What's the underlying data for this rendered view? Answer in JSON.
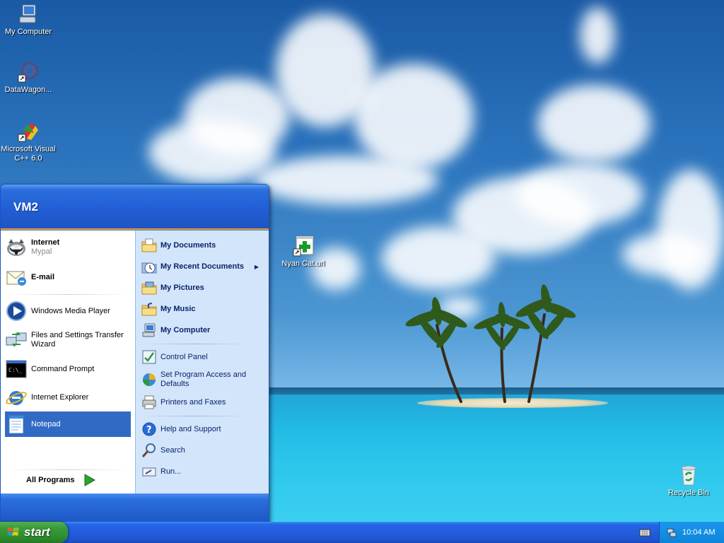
{
  "desktop": {
    "icons": [
      {
        "label": "My Computer",
        "icon": "my-computer-icon"
      },
      {
        "label": "DataWagon...",
        "icon": "datawagon-icon"
      },
      {
        "label": "Microsoft Visual C++ 6.0",
        "icon": "visual-cpp-icon"
      },
      {
        "label": "Nyan Cat.url",
        "icon": "internet-shortcut-icon"
      },
      {
        "label": "Recycle Bin",
        "icon": "recycle-bin-icon"
      }
    ]
  },
  "start_menu": {
    "user": "VM2",
    "pinned": [
      {
        "label": "Internet",
        "sub": "Mypal",
        "icon": "mypal-browser-icon"
      },
      {
        "label": "E-mail",
        "icon": "email-icon"
      }
    ],
    "recent": [
      {
        "label": "Windows Media Player",
        "icon": "media-player-icon"
      },
      {
        "label": "Files and Settings Transfer Wizard",
        "icon": "transfer-wizard-icon"
      },
      {
        "label": "Command Prompt",
        "icon": "command-prompt-icon"
      },
      {
        "label": "Internet Explorer",
        "icon": "internet-explorer-icon"
      },
      {
        "label": "Notepad",
        "icon": "notepad-icon"
      }
    ],
    "all_programs": "All Programs",
    "places": [
      {
        "label": "My Documents",
        "icon": "my-documents-icon"
      },
      {
        "label": "My Recent Documents",
        "icon": "recent-documents-icon"
      },
      {
        "label": "My Pictures",
        "icon": "my-pictures-icon"
      },
      {
        "label": "My Music",
        "icon": "my-music-icon"
      },
      {
        "label": "My Computer",
        "icon": "my-computer-icon"
      }
    ],
    "settings": [
      {
        "label": "Control Panel",
        "icon": "control-panel-icon"
      },
      {
        "label": "Set Program Access and Defaults",
        "icon": "program-access-icon"
      },
      {
        "label": "Printers and Faxes",
        "icon": "printer-icon"
      }
    ],
    "help": [
      {
        "label": "Help and Support",
        "icon": "help-icon"
      },
      {
        "label": "Search",
        "icon": "search-icon"
      },
      {
        "label": "Run...",
        "icon": "run-icon"
      }
    ]
  },
  "taskbar": {
    "start_label": "start",
    "clock": "10:04 AM"
  },
  "colors": {
    "taskbar_blue": "#245cdc",
    "start_green": "#3a9a3a",
    "selection_blue": "#316ac5",
    "places_panel": "#d3e5fa"
  }
}
